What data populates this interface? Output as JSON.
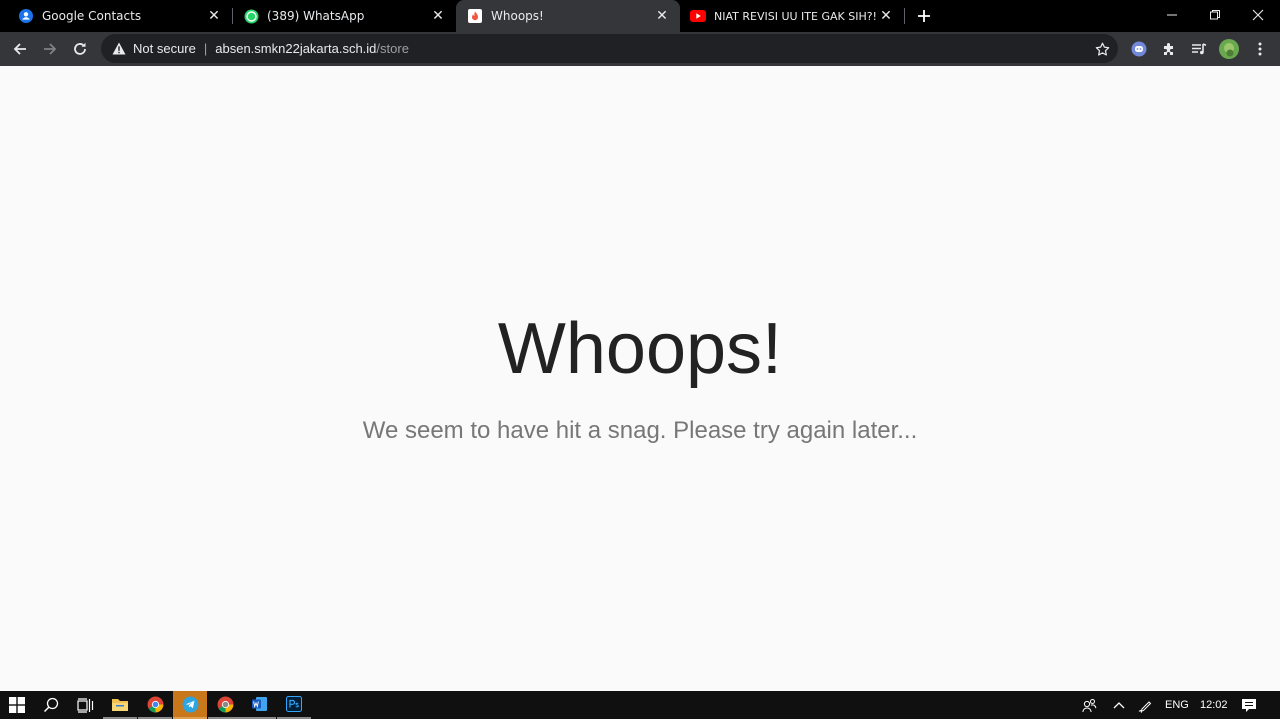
{
  "browser": {
    "tabs": [
      {
        "title": "Google Contacts",
        "icon": "google-contacts-icon"
      },
      {
        "title": "(389) WhatsApp",
        "icon": "whatsapp-icon"
      },
      {
        "title": "Whoops!",
        "icon": "laravel-icon",
        "active": true
      },
      {
        "title": "NIAT REVISI UU ITE GAK SIH?! | M",
        "icon": "youtube-icon"
      }
    ],
    "address": {
      "security_label": "Not secure",
      "separator": "|",
      "host": "absen.smkn22jakarta.sch.id",
      "path": "/store"
    }
  },
  "page": {
    "headline": "Whoops!",
    "message": "We seem to have hit a snag. Please try again later..."
  },
  "taskbar": {
    "language": "ENG",
    "clock": "12:02"
  },
  "colors": {
    "tab_strip": "#000000",
    "toolbar": "#35363a",
    "omnibox": "#202124",
    "page_background": "#fafafa",
    "headline": "#222222",
    "message": "#777777",
    "taskbar": "#101010",
    "telegram_active": "#c8771a"
  }
}
